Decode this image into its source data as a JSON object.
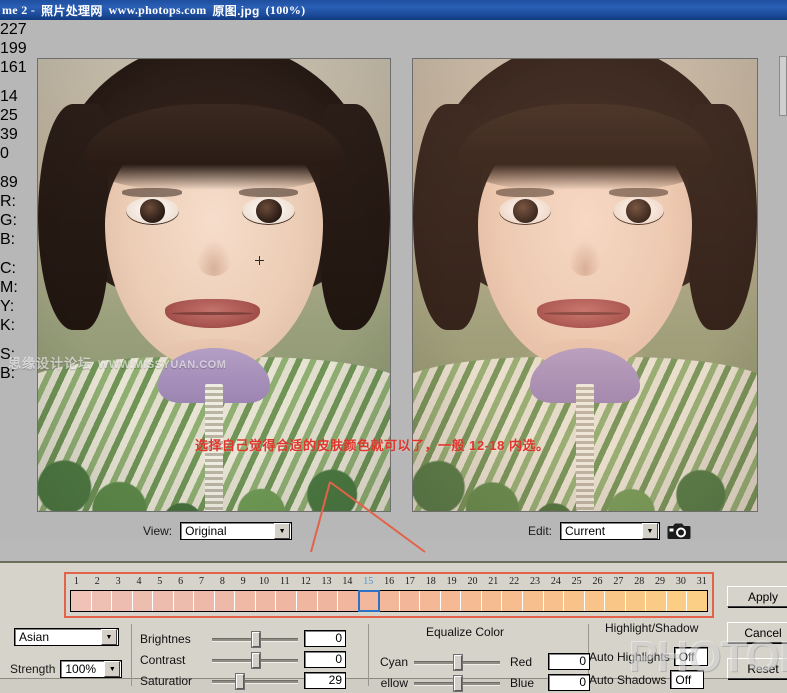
{
  "window": {
    "title_prefix": "me 2 -",
    "title_site_cn": "照片处理网",
    "title_site_url": "www.photops.com",
    "title_file": "原图.jpg",
    "title_zoom": "(100%)"
  },
  "workarea": {
    "left_readout": [
      "227",
      "199",
      "161",
      "14",
      "25",
      "39",
      "0",
      "89"
    ],
    "right_labels": [
      "R:",
      "G:",
      "B:",
      "C:",
      "M:",
      "Y:",
      "K:",
      "S:",
      "B:"
    ],
    "watermark_cn": "思缘设计论坛",
    "watermark_en": "WWW.MISSYUAN.COM",
    "watermark_photops": "PHOTOPS.COM",
    "annotation": "选择自己觉得合适的皮肤颜色就可以了，一般 12-18 内选。"
  },
  "toolbar": {
    "view_label": "View:",
    "view_value": "Original",
    "edit_label": "Edit:",
    "edit_value": "Current",
    "camera_icon": "camera-icon",
    "dropdown_arrow": "▼"
  },
  "swatches": {
    "numbers": [
      "1",
      "2",
      "3",
      "4",
      "5",
      "6",
      "7",
      "8",
      "9",
      "10",
      "11",
      "12",
      "13",
      "14",
      "15",
      "16",
      "17",
      "18",
      "19",
      "20",
      "21",
      "22",
      "23",
      "24",
      "25",
      "26",
      "27",
      "28",
      "29",
      "30",
      "31"
    ],
    "selected_index": 15,
    "colors": [
      "#efc3b7",
      "#eebfb3",
      "#eebdb1",
      "#edbdb0",
      "#edbcae",
      "#eebcad",
      "#eeb9a9",
      "#eeb9a8",
      "#efb9a6",
      "#efb8a4",
      "#efb7a2",
      "#f0b6a0",
      "#f0b59e",
      "#f1b69d",
      "#f2b79c",
      "#f3b79a",
      "#f3b698",
      "#f4b896",
      "#f5b994",
      "#f6bb93",
      "#f6bc91",
      "#f7bd8f",
      "#f7bf8e",
      "#f8c08c",
      "#f8c28b",
      "#f9c489",
      "#f9c688",
      "#fac886",
      "#facb86",
      "#fbcd85",
      "#fbcf85"
    ]
  },
  "preset": {
    "skin_type": "Asian",
    "strength_label": "Strength",
    "strength_value": "100%"
  },
  "adjust": {
    "brightness_label": "Brightnes",
    "brightness_value": "0",
    "contrast_label": "Contrast",
    "contrast_value": "0",
    "saturation_label": "Saturatior",
    "saturation_value": "29"
  },
  "equalize": {
    "title": "Equalize Color",
    "cyan_label": "Cyan",
    "red_label": "Red",
    "red_value": "0",
    "yellow_label": "ellow",
    "blue_label": "Blue",
    "blue_value": "0"
  },
  "highlight_shadow": {
    "title": "Highlight/Shadow",
    "auto_highlights_label": "Auto Highlights",
    "auto_highlights_value": "Off",
    "auto_shadows_label": "Auto Shadows",
    "auto_shadows_value": "Off"
  },
  "buttons": {
    "apply": "Apply",
    "cancel": "Cancel",
    "reset": "Reset"
  },
  "colors": {
    "titlebar": "#1e4fa0",
    "accent_red": "#e2624a",
    "selection_blue": "#2f72c4",
    "panel_bg": "#d6d3ca",
    "annotation_red": "#e0352b"
  }
}
